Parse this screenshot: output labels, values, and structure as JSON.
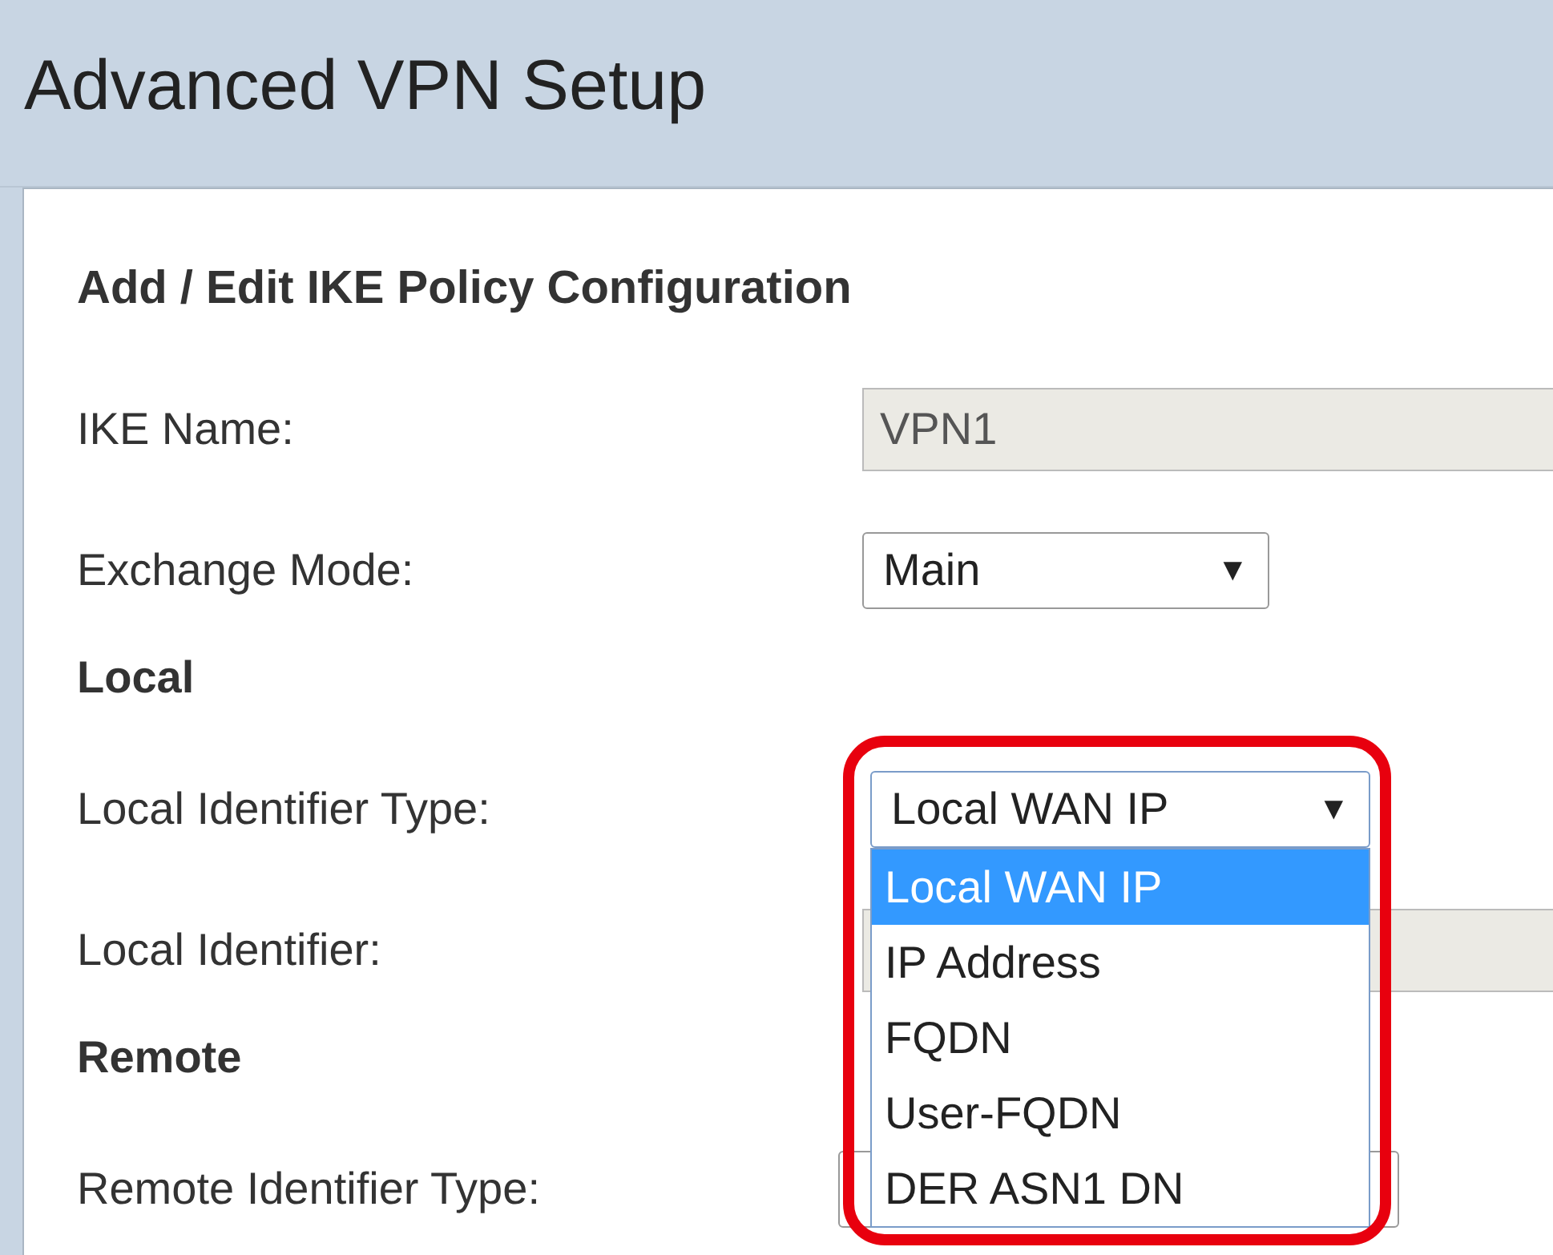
{
  "page": {
    "title": "Advanced VPN Setup"
  },
  "panel": {
    "title": "Add / Edit IKE Policy Configuration",
    "rows": [
      {
        "kind": "text",
        "label": "IKE Name:",
        "value": "VPN1",
        "disabled": true
      },
      {
        "kind": "select",
        "label": "Exchange Mode:",
        "value": "Main",
        "arrow": "▼"
      },
      {
        "kind": "section",
        "label": "Local"
      },
      {
        "kind": "select",
        "label": "Local Identifier Type:",
        "value": "Local WAN IP",
        "arrow": "▼",
        "expanded": true,
        "highlighted": true,
        "options": [
          {
            "label": "Local WAN IP",
            "selected": true
          },
          {
            "label": "IP Address",
            "selected": false
          },
          {
            "label": "FQDN",
            "selected": false
          },
          {
            "label": "User-FQDN",
            "selected": false
          },
          {
            "label": "DER ASN1 DN",
            "selected": false
          }
        ]
      },
      {
        "kind": "text",
        "label": "Local Identifier:",
        "disabled": true
      },
      {
        "kind": "section",
        "label": "Remote"
      },
      {
        "kind": "select",
        "label": "Remote Identifier Type:"
      }
    ]
  }
}
